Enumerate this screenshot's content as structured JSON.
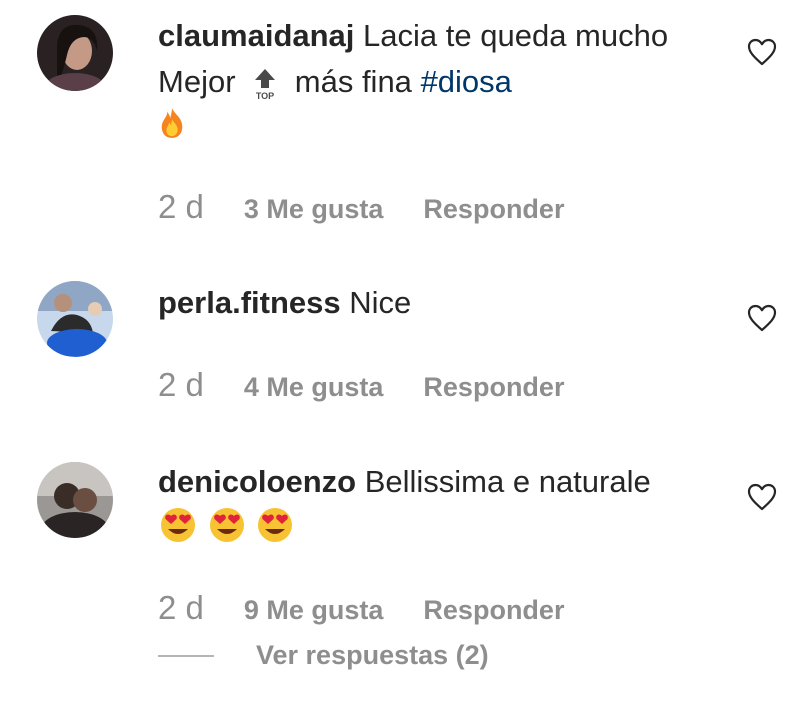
{
  "comments": [
    {
      "username": "claumaidanaj",
      "text_before": "Lacia te queda mucho Mejor",
      "text_after": "más fina",
      "hashtag": "#diosa",
      "time": "2 d",
      "likes": "3 Me gusta",
      "reply": "Responder",
      "icons": [
        "top-arrow-icon",
        "fire-icon"
      ]
    },
    {
      "username": "perla.fitness",
      "text": "Nice",
      "time": "2 d",
      "likes": "4 Me gusta",
      "reply": "Responder"
    },
    {
      "username": "denicoloenzo",
      "text": "Bellissima e naturale",
      "time": "2 d",
      "likes": "9 Me gusta",
      "reply": "Responder",
      "icons": [
        "heart-eyes-icon",
        "heart-eyes-icon",
        "heart-eyes-icon"
      ]
    }
  ],
  "view_replies": "Ver respuestas (2)",
  "colors": {
    "text": "#262626",
    "meta": "#8e8e8e",
    "hashtag": "#00376b"
  }
}
